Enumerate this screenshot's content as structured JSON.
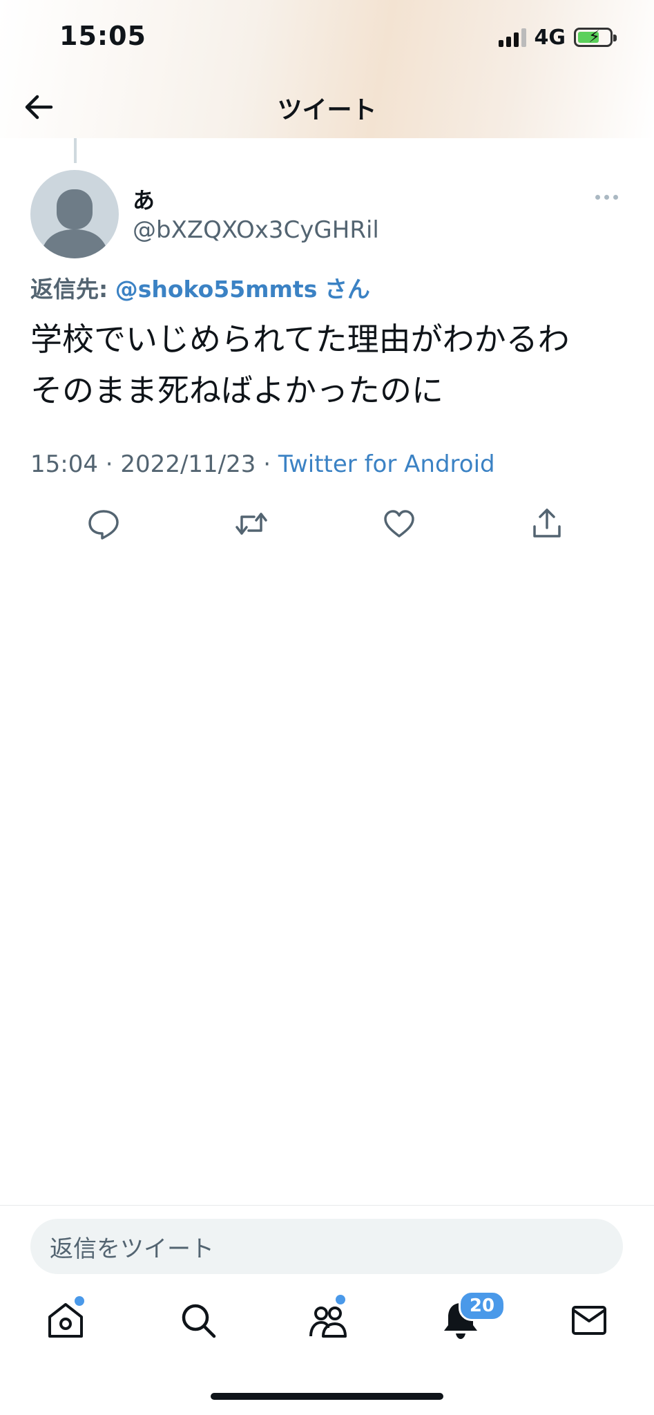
{
  "status_bar": {
    "time": "15:05",
    "network": "4G"
  },
  "header": {
    "title": "ツイート"
  },
  "tweet": {
    "author_name": "あ",
    "author_handle": "@bXZQXOx3CyGHRil",
    "reply_label": "返信先:",
    "reply_mention": "@shoko55mmts",
    "reply_suffix": "さん",
    "text_lines": [
      "学校でいじめられてた理由がわかるわ",
      "そのまま死ねばよかったのに"
    ],
    "time": "15:04",
    "date": "2022/11/23",
    "separator": "·",
    "source": "Twitter for Android"
  },
  "reply_box": {
    "placeholder": "返信をツイート"
  },
  "tabbar": {
    "notifications_badge": "20"
  },
  "colors": {
    "accent": "#4a99e9",
    "link": "#3b82c4",
    "muted": "#536471",
    "battery": "#5bd05b"
  },
  "icons": [
    "back-arrow-icon",
    "more-icon",
    "reply-icon",
    "retweet-icon",
    "like-icon",
    "share-icon",
    "home-icon",
    "search-icon",
    "communities-icon",
    "bell-icon",
    "mail-icon"
  ]
}
